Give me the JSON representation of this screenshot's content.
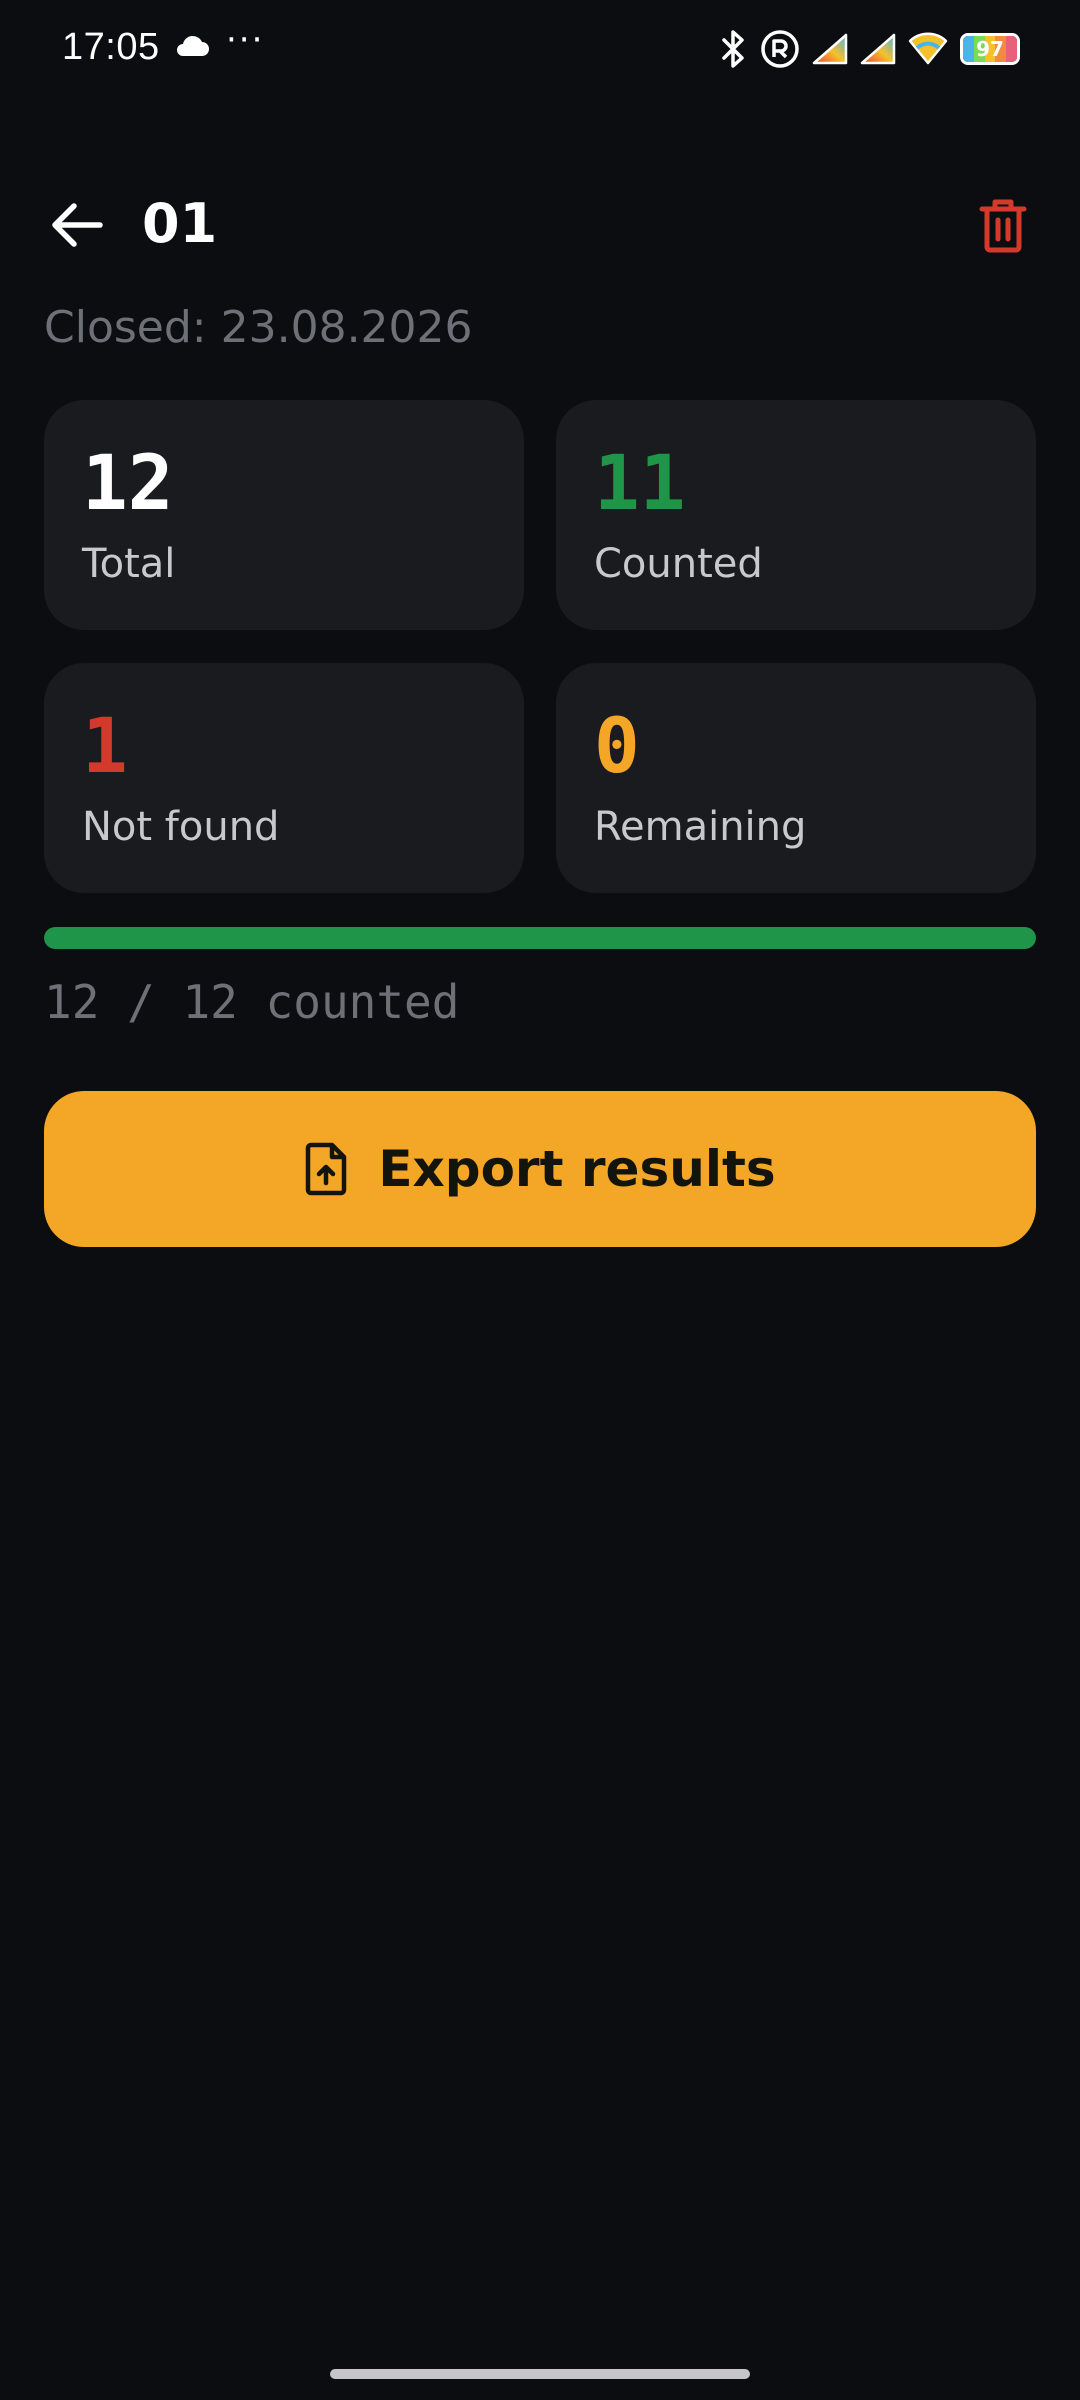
{
  "status_bar": {
    "time": "17:05",
    "more": "···",
    "battery_level": "97"
  },
  "header": {
    "title": "01"
  },
  "closed_text": "Closed: 23.08.2026",
  "stats": [
    {
      "value": "12",
      "label": "Total",
      "color": "#ffffff"
    },
    {
      "value": "11",
      "label": "Counted",
      "color": "#1e9548"
    },
    {
      "value": "1",
      "label": "Not found",
      "color": "#d33a2c"
    },
    {
      "value": "0",
      "label": "Remaining",
      "color": "#f4a726"
    }
  ],
  "progress": {
    "fraction": 1.0,
    "text": "12 / 12 counted",
    "color": "#1e9548"
  },
  "export_button": {
    "label": "Export results",
    "color": "#f4a726"
  },
  "colors": {
    "background": "#0c0d10",
    "card": "#1a1b1e",
    "danger": "#d33a2c"
  }
}
